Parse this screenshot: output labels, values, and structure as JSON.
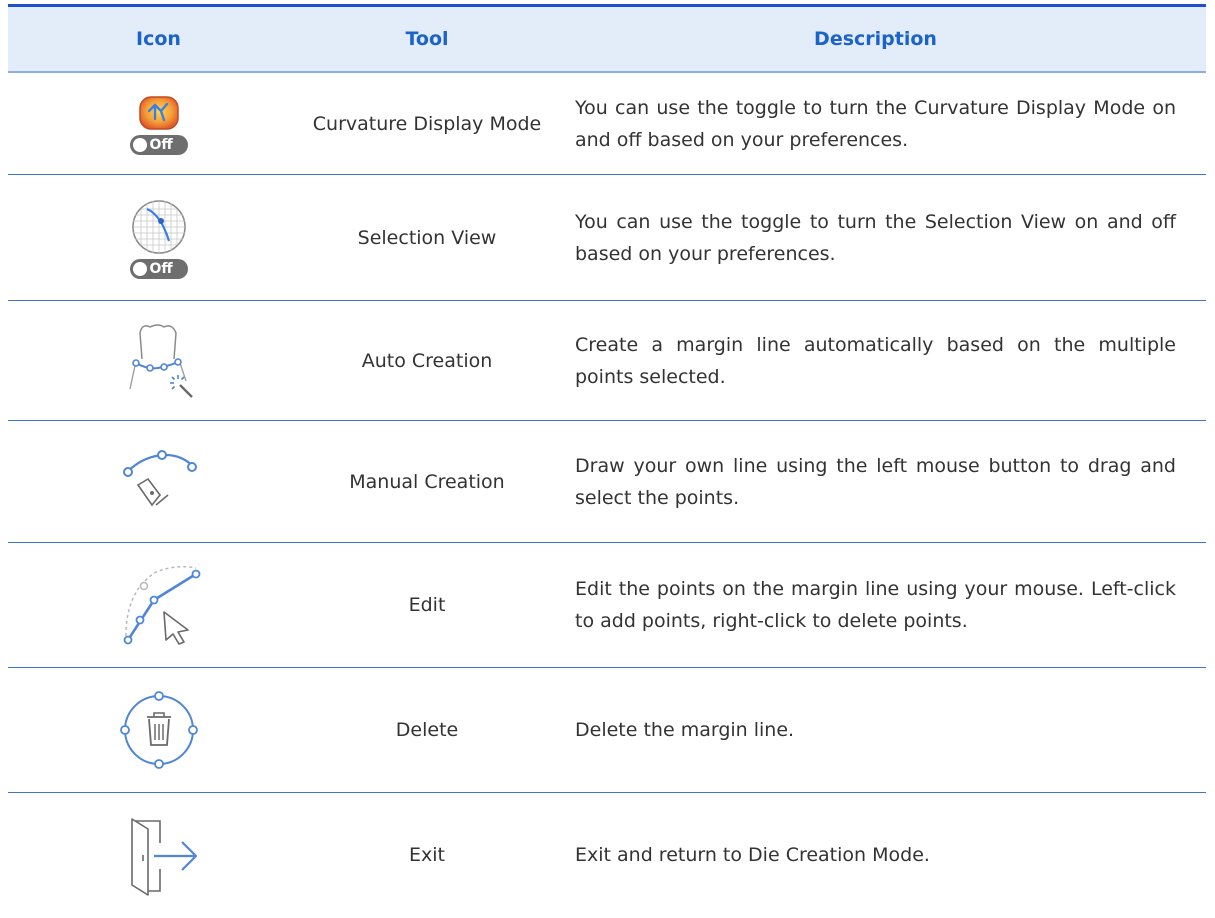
{
  "table": {
    "headers": {
      "icon": "Icon",
      "tool": "Tool",
      "description": "Description"
    },
    "rows": [
      {
        "icon": "curvature-display-icon",
        "toggle": "Off",
        "tool": "Curvature Display Mode",
        "description": "You can use the toggle to turn the Curvature Display Mode on and off based on your preferences."
      },
      {
        "icon": "selection-view-icon",
        "toggle": "Off",
        "tool": "Selection View",
        "description": "You can use the toggle to turn the Selection View on and off based on your preferences."
      },
      {
        "icon": "auto-creation-icon",
        "tool": "Auto Creation",
        "description": "Create a margin line automatically based on the multiple points selected."
      },
      {
        "icon": "manual-creation-icon",
        "tool": "Manual Creation",
        "description": "Draw your own line using the left mouse button to drag and select the points."
      },
      {
        "icon": "edit-icon",
        "tool": "Edit",
        "description": "Edit the points on the margin line using your mouse. Left-click to add points, right-click to delete points."
      },
      {
        "icon": "delete-icon",
        "tool": "Delete",
        "description": "Delete the margin line."
      },
      {
        "icon": "exit-icon",
        "tool": "Exit",
        "description": "Exit and return to Die Creation Mode."
      }
    ]
  },
  "colors": {
    "header_text": "#1b63c8",
    "header_bg": "#e3edf9",
    "rule": "#3f74c9",
    "icon_blue": "#4f86d6"
  }
}
